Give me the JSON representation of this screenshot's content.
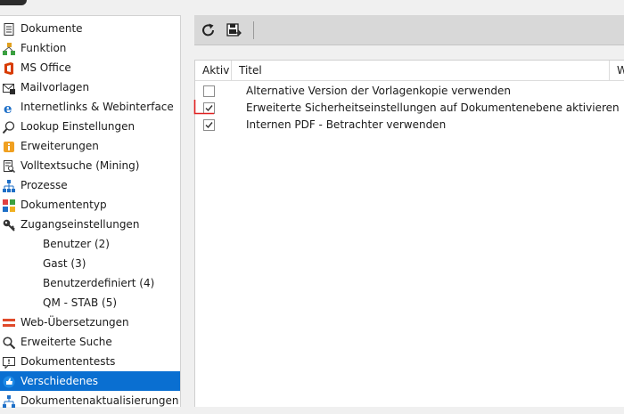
{
  "sidebar": {
    "items": [
      {
        "label": "Dokumente",
        "icon": "document-icon"
      },
      {
        "label": "Funktion",
        "icon": "function-tree-icon"
      },
      {
        "label": "MS Office",
        "icon": "ms-office-icon"
      },
      {
        "label": "Mailvorlagen",
        "icon": "mail-template-icon"
      },
      {
        "label": "Internetlinks & Webinterface",
        "icon": "internet-explorer-icon"
      },
      {
        "label": "Lookup Einstellungen",
        "icon": "magnifier-icon"
      },
      {
        "label": "Erweiterungen",
        "icon": "extension-icon"
      },
      {
        "label": "Volltextsuche (Mining)",
        "icon": "fulltext-search-icon"
      },
      {
        "label": "Prozesse",
        "icon": "process-tree-icon"
      },
      {
        "label": "Dokumententyp",
        "icon": "document-type-icon"
      },
      {
        "label": "Zugangseinstellungen",
        "icon": "key-icon"
      },
      {
        "label": "Benutzer (2)",
        "icon": ""
      },
      {
        "label": "Gast (3)",
        "icon": ""
      },
      {
        "label": "Benutzerdefiniert (4)",
        "icon": ""
      },
      {
        "label": "QM - STAB (5)",
        "icon": ""
      },
      {
        "label": "Web-Übersetzungen",
        "icon": "translation-icon"
      },
      {
        "label": "Erweiterte Suche",
        "icon": "advanced-search-icon"
      },
      {
        "label": "Dokumententests",
        "icon": "document-test-icon"
      },
      {
        "label": "Verschiedenes",
        "icon": "misc-icon"
      },
      {
        "label": "Dokumentenaktualisierungen",
        "icon": "document-update-icon"
      }
    ],
    "active_index": 18
  },
  "toolbar": {
    "refresh_icon": "refresh-icon",
    "save_icon": "save-settings-icon"
  },
  "grid": {
    "columns": [
      "Aktiv",
      "Titel",
      "We"
    ],
    "rows": [
      {
        "active": false,
        "title": "Alternative Version der Vorlagenkopie verwenden"
      },
      {
        "active": true,
        "title": "Erweiterte Sicherheitseinstellungen auf Dokumentenebene aktivieren"
      },
      {
        "active": true,
        "title": "Internen PDF - Betrachter verwenden"
      }
    ]
  },
  "colors": {
    "active_item": "#0a6fd1",
    "toolbar": "#d8d8d8",
    "annotation": "#e02020"
  }
}
